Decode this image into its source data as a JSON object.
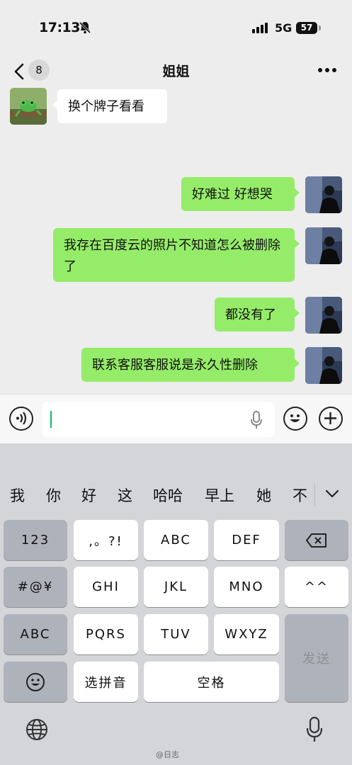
{
  "status_bar": {
    "time": "17:13",
    "network": "5G",
    "battery": "57"
  },
  "nav": {
    "badge_count": "8",
    "title": "姐姐"
  },
  "messages": [
    {
      "from": "contact",
      "text": "换个牌子看看"
    },
    {
      "from": "me",
      "text": "好难过 好想哭"
    },
    {
      "from": "me",
      "text": "我存在百度云的照片不知道怎么被删除了"
    },
    {
      "from": "me",
      "text": "都没有了"
    },
    {
      "from": "me",
      "text": "联系客服客服说是永久性删除"
    }
  ],
  "keyboard": {
    "candidates": [
      "我",
      "你",
      "好",
      "这",
      "哈哈",
      "早上",
      "她",
      "不"
    ],
    "keys": {
      "numbers": "123",
      "punct": ",。?!",
      "abc": "ABC",
      "def": "DEF",
      "symbols": "#@¥",
      "ghi": "GHI",
      "jkl": "JKL",
      "mno": "MNO",
      "face": "^^",
      "abc_mode": "ABC",
      "pqrs": "PQRS",
      "tuv": "TUV",
      "wxyz": "WXYZ",
      "send": "发送",
      "pinyin": "选拼音",
      "space": "空格"
    }
  },
  "watermark": "@日志",
  "colors": {
    "outgoing_bubble": "#95ec69",
    "incoming_bubble": "#ffffff",
    "caret": "#07c160"
  }
}
